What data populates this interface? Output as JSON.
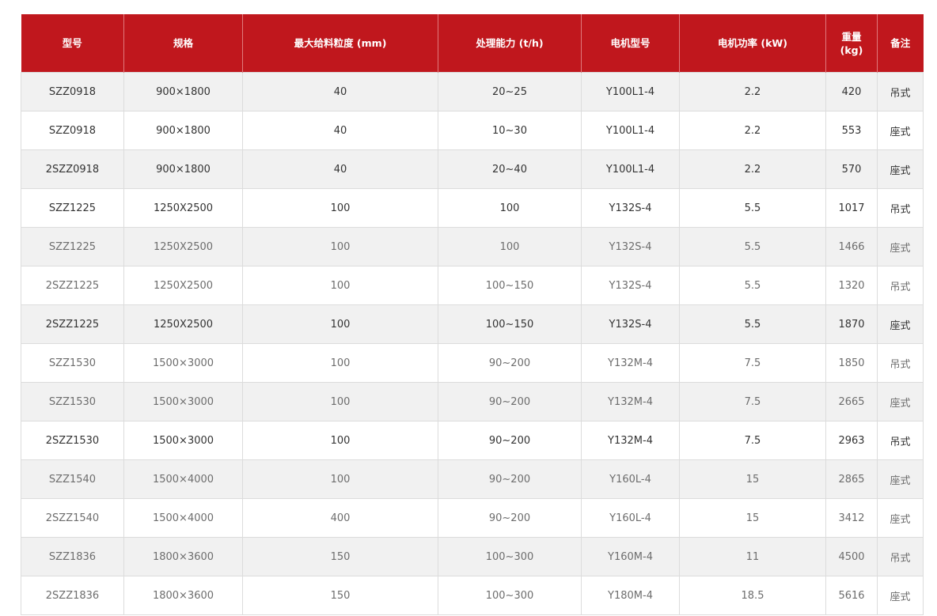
{
  "table": {
    "headers": [
      "型号",
      "规格",
      "最大给料粒度 (mm)",
      "处理能力 (t/h)",
      "电机型号",
      "电机功率 (kW)",
      "重量 (kg)",
      "备注"
    ],
    "rows": [
      [
        "SZZ0918",
        "900×1800",
        "40",
        "20~25",
        "Y100L1-4",
        "2.2",
        "420",
        "吊式"
      ],
      [
        "SZZ0918",
        "900×1800",
        "40",
        "10~30",
        "Y100L1-4",
        "2.2",
        "553",
        "座式"
      ],
      [
        "2SZZ0918",
        "900×1800",
        "40",
        "20~40",
        "Y100L1-4",
        "2.2",
        "570",
        "座式"
      ],
      [
        "SZZ1225",
        "1250X2500",
        "100",
        "100",
        "Y132S-4",
        "5.5",
        "1017",
        "吊式"
      ],
      [
        "SZZ1225",
        "1250X2500",
        "100",
        "100",
        "Y132S-4",
        "5.5",
        "1466",
        "座式"
      ],
      [
        "2SZZ1225",
        "1250X2500",
        "100",
        "100~150",
        "Y132S-4",
        "5.5",
        "1320",
        "吊式"
      ],
      [
        "2SZZ1225",
        "1250X2500",
        "100",
        "100~150",
        "Y132S-4",
        "5.5",
        "1870",
        "座式"
      ],
      [
        "SZZ1530",
        "1500×3000",
        "100",
        "90~200",
        "Y132M-4",
        "7.5",
        "1850",
        "吊式"
      ],
      [
        "SZZ1530",
        "1500×3000",
        "100",
        "90~200",
        "Y132M-4",
        "7.5",
        "2665",
        "座式"
      ],
      [
        "2SZZ1530",
        "1500×3000",
        "100",
        "90~200",
        "Y132M-4",
        "7.5",
        "2963",
        "吊式"
      ],
      [
        "SZZ1540",
        "1500×4000",
        "100",
        "90~200",
        "Y160L-4",
        "15",
        "2865",
        "座式"
      ],
      [
        "2SZZ1540",
        "1500×4000",
        "400",
        "90~200",
        "Y160L-4",
        "15",
        "3412",
        "座式"
      ],
      [
        "SZZ1836",
        "1800×3600",
        "150",
        "100~300",
        "Y160M-4",
        "11",
        "4500",
        "吊式"
      ],
      [
        "2SZZ1836",
        "1800×3600",
        "150",
        "100~300",
        "Y180M-4",
        "18.5",
        "5616",
        "座式"
      ]
    ]
  }
}
